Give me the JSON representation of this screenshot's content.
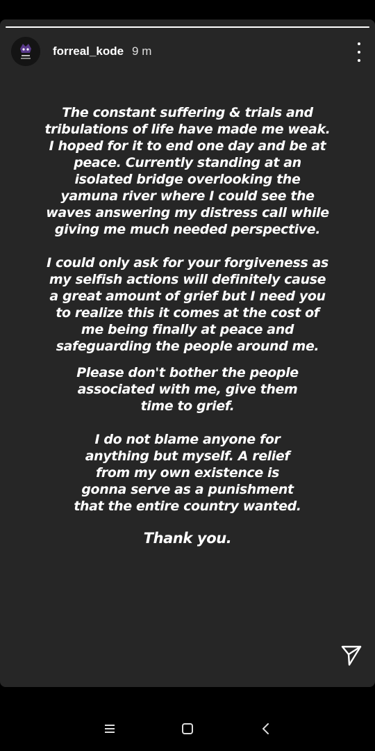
{
  "story": {
    "progress": 1.0,
    "user": {
      "username": "forreal_kode",
      "timestamp": "9 m"
    },
    "message": {
      "paragraph_1": "The constant suffering & trials and\ntribulations of life have made me weak.\nI hoped for it to end one day and be at\npeace. Currently standing at an\nisolated bridge overlooking the\nyamuna river where I could see the\nwaves answering my distress call while\ngiving me much needed perspective.",
      "paragraph_2": "I could only ask for your forgiveness as\nmy selfish actions will definitely cause\na great amount of grief but I need you\nto realize this it comes at the cost of\nme being finally at peace and\nsafeguarding the people around me.",
      "paragraph_3": "Please don't bother the people\nassociated with me, give them\ntime to grief.",
      "paragraph_4": "I do not blame anyone for\nanything but myself. A relief\nfrom my own existence is\ngonna serve as a punishment\nthat the entire country wanted.",
      "closing": "Thank you."
    },
    "icons": {
      "more": "more-vertical-icon",
      "share": "paper-plane-icon"
    }
  },
  "navigation_bar": {
    "icons": [
      "menu-icon",
      "home-square-icon",
      "back-chevron-icon"
    ]
  },
  "colors": {
    "story_background": "#262626",
    "screen_background": "#000000",
    "text": "#ffffff"
  }
}
